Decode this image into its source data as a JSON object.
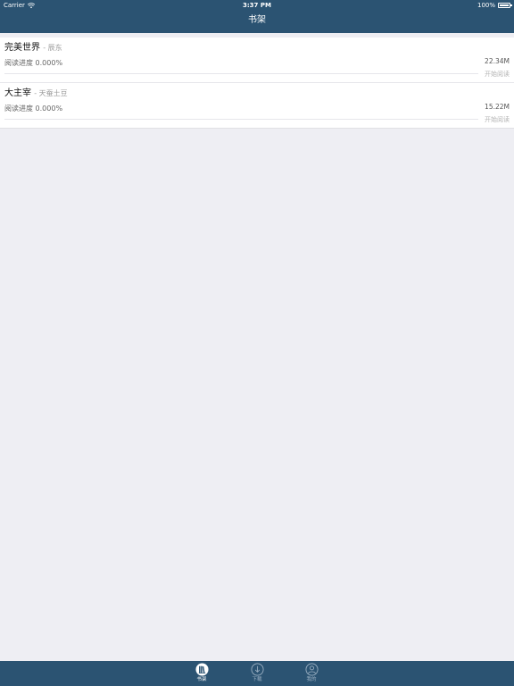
{
  "status_bar": {
    "carrier": "Carrier",
    "time": "3:37 PM",
    "battery": "100%"
  },
  "nav": {
    "title": "书架"
  },
  "books": [
    {
      "title": "完美世界",
      "author": "- 辰东",
      "progress": "阅读进度 0.000%",
      "size": "22.34M",
      "action": "开始阅读"
    },
    {
      "title": "大主宰",
      "author": "- 天蚕土豆",
      "progress": "阅读进度 0.000%",
      "size": "15.22M",
      "action": "开始阅读"
    }
  ],
  "tabbar": {
    "tabs": [
      {
        "label": "书架",
        "icon": "bookshelf-icon",
        "active": true
      },
      {
        "label": "下载",
        "icon": "download-icon",
        "active": false
      },
      {
        "label": "我的",
        "icon": "user-icon",
        "active": false
      }
    ]
  },
  "colors": {
    "bar": "#2b5372",
    "background": "#eeeef3"
  }
}
